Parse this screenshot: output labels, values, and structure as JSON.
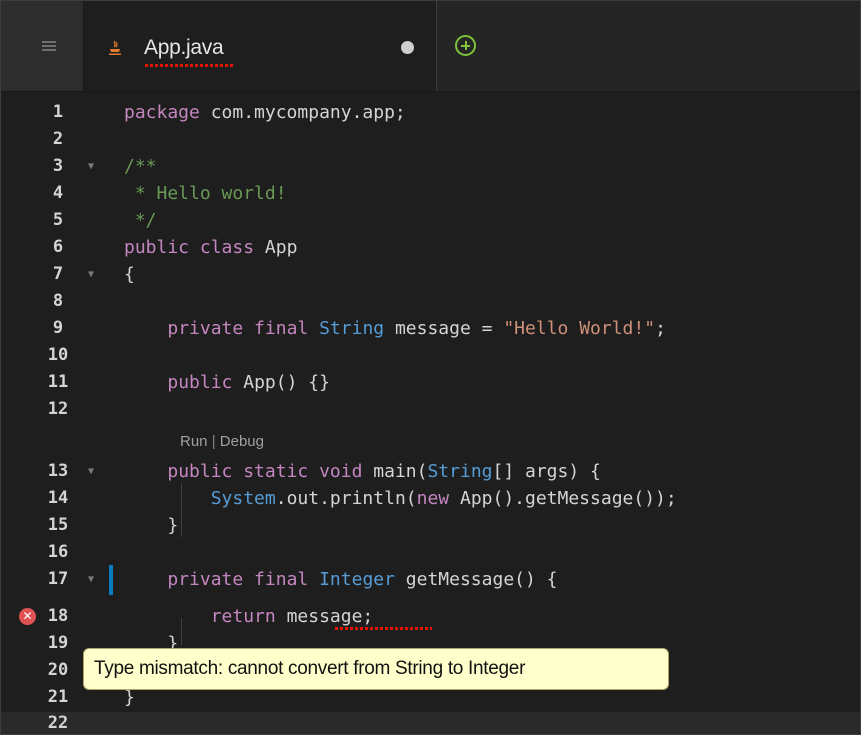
{
  "tab": {
    "label": "App.java"
  },
  "code_lines": [
    {
      "n": "1",
      "text": "package com.mycompany.app;"
    },
    {
      "n": "2",
      "text": ""
    },
    {
      "n": "3",
      "text": "/**"
    },
    {
      "n": "4",
      "text": " * Hello world!"
    },
    {
      "n": "5",
      "text": " */"
    },
    {
      "n": "6",
      "text": "public class App"
    },
    {
      "n": "7",
      "text": "{"
    },
    {
      "n": "8",
      "text": ""
    },
    {
      "n": "9",
      "text": "    private final String message = \"Hello World!\";"
    },
    {
      "n": "10",
      "text": ""
    },
    {
      "n": "11",
      "text": "    public App() {}"
    },
    {
      "n": "12",
      "text": ""
    },
    {
      "n": "13",
      "text": "    public static void main(String[] args) {"
    },
    {
      "n": "14",
      "text": "        System.out.println(new App().getMessage());"
    },
    {
      "n": "15",
      "text": "    }"
    },
    {
      "n": "16",
      "text": ""
    },
    {
      "n": "17",
      "text": "    private final Integer getMessage() {"
    },
    {
      "n": "18",
      "text": "        return message;"
    },
    {
      "n": "19",
      "text": "    }"
    },
    {
      "n": "20",
      "text": ""
    },
    {
      "n": "21",
      "text": "}"
    },
    {
      "n": "22",
      "text": ""
    }
  ],
  "codelens": {
    "run": "Run",
    "separator": "|",
    "debug": "Debug"
  },
  "error": {
    "message": "Type mismatch: cannot convert from String to Integer",
    "line": "18",
    "symbol": "message"
  },
  "colors": {
    "keyword": "#c586c0",
    "type": "#569cd6",
    "string": "#ce9178",
    "comment": "#6a9955",
    "error": "#e05252",
    "tooltip_bg": "#ffffcc",
    "add_icon": "#7fc23a"
  },
  "icons": {
    "menu": "hamburger-icon",
    "file": "java-file-icon",
    "modified": "unsaved-dot-icon",
    "add": "add-tab-icon",
    "error": "error-icon"
  }
}
